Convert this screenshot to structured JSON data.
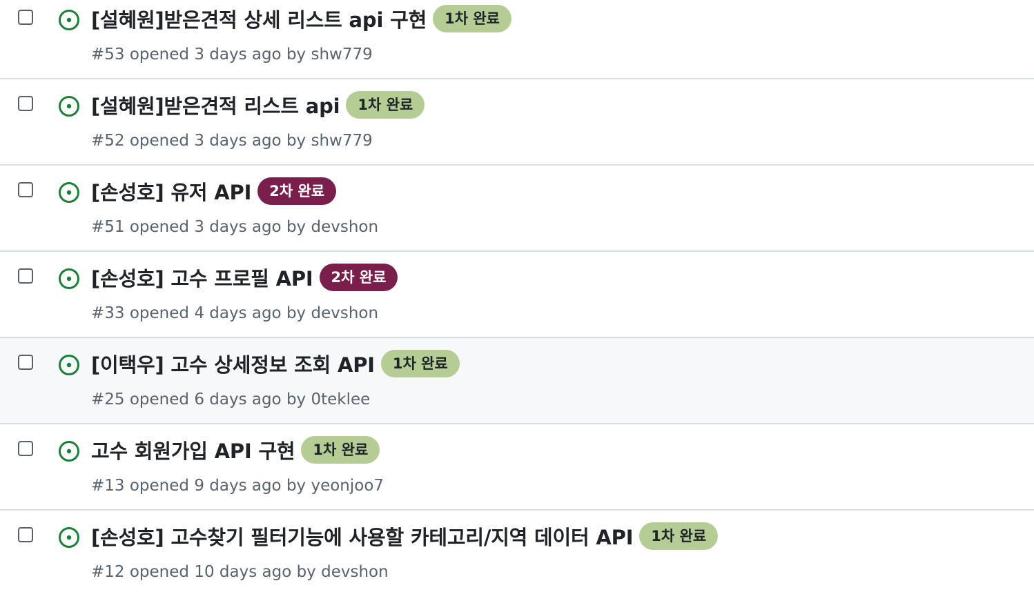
{
  "issues": [
    {
      "title": "[설혜원]받은견적 상세 리스트 api 구현",
      "label": "1차 완료",
      "label_kind": "first",
      "number": "#53",
      "opened": "opened 3 days ago by",
      "author": "shw779"
    },
    {
      "title": "[설혜원]받은견적 리스트 api",
      "label": "1차 완료",
      "label_kind": "first",
      "number": "#52",
      "opened": "opened 3 days ago by",
      "author": "shw779"
    },
    {
      "title": "[손성호] 유저 API",
      "label": "2차 완료",
      "label_kind": "second",
      "number": "#51",
      "opened": "opened 3 days ago by",
      "author": "devshon"
    },
    {
      "title": "[손성호] 고수 프로필 API",
      "label": "2차 완료",
      "label_kind": "second",
      "number": "#33",
      "opened": "opened 4 days ago by",
      "author": "devshon"
    },
    {
      "title": "[이택우] 고수 상세정보 조회 API",
      "label": "1차 완료",
      "label_kind": "first",
      "number": "#25",
      "opened": "opened 6 days ago by",
      "author": "0teklee"
    },
    {
      "title": "고수 회원가입 API 구현",
      "label": "1차 완료",
      "label_kind": "first",
      "number": "#13",
      "opened": "opened 9 days ago by",
      "author": "yeonjoo7"
    },
    {
      "title": "[손성호] 고수찾기 필터기능에 사용할 카테고리/지역 데이터 API",
      "label": "1차 완료",
      "label_kind": "first",
      "number": "#12",
      "opened": "opened 10 days ago by",
      "author": "devshon"
    }
  ],
  "icons": {
    "status": "issue-opened-icon"
  },
  "colors": {
    "open_icon": "#1a7f37",
    "label_first": "#b5cc94",
    "label_second": "#7a1f4b"
  }
}
